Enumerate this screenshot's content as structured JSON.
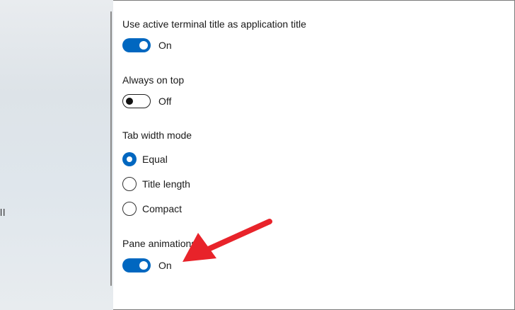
{
  "sidebar": {
    "partial_text": "ll"
  },
  "settings": {
    "terminal_title": {
      "label": "Use active terminal title as application title",
      "state": "On"
    },
    "always_on_top": {
      "label": "Always on top",
      "state": "Off"
    },
    "tab_width_mode": {
      "label": "Tab width mode",
      "options": [
        "Equal",
        "Title length",
        "Compact"
      ],
      "selected": "Equal"
    },
    "pane_animations": {
      "label": "Pane animations",
      "state": "On"
    }
  },
  "colors": {
    "accent": "#0067c0",
    "annotation_arrow": "#e8232a"
  }
}
